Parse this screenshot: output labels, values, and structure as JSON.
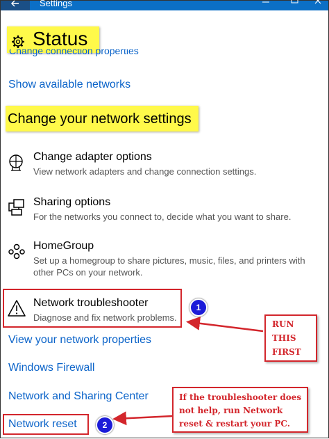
{
  "window": {
    "title": "Settings"
  },
  "status": {
    "heading": "Status"
  },
  "links": {
    "change_connection": "Change connection properties",
    "show_networks": "Show available networks"
  },
  "section": {
    "heading": "Change your network settings"
  },
  "options": [
    {
      "title": "Change adapter options",
      "desc": "View network adapters and change connection settings.",
      "icon": "adapter-icon"
    },
    {
      "title": "Sharing options",
      "desc": "For the networks you connect to, decide what you want to share.",
      "icon": "sharing-icon"
    },
    {
      "title": "HomeGroup",
      "desc": "Set up a homegroup to share pictures, music, files, and printers with other PCs on your network.",
      "icon": "homegroup-icon"
    },
    {
      "title": "Network troubleshooter",
      "desc": "Diagnose and fix network problems.",
      "icon": "warning-icon"
    }
  ],
  "bottom_links": {
    "properties": "View your network properties",
    "firewall": "Windows Firewall",
    "sharing_center": "Network and Sharing Center",
    "reset": "Network reset"
  },
  "annotations": {
    "callout1": {
      "line1": "RUN",
      "line2": "THIS",
      "line3": "FIRST"
    },
    "callout2": {
      "line1": "If the troubleshooter does",
      "line2": "not help, run Network",
      "line3": "reset & restart your PC."
    },
    "badge1": "1",
    "badge2": "2"
  },
  "colors": {
    "accent": "#0a63c9",
    "highlight": "#fff94a",
    "annotation": "#d3262c",
    "badge": "#1c1cd8"
  }
}
